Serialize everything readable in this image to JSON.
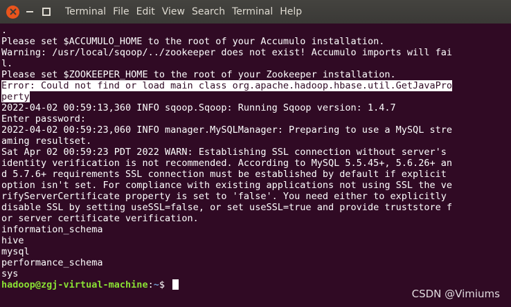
{
  "titlebar": {
    "menu": [
      "Terminal",
      "File",
      "Edit",
      "View",
      "Search",
      "Terminal",
      "Help"
    ]
  },
  "terminal": {
    "lines": [
      ".",
      "Please set $ACCUMULO_HOME to the root of your Accumulo installation.",
      "Warning: /usr/local/sqoop/../zookeeper does not exist! Accumulo imports will fai",
      "l.",
      "Please set $ZOOKEEPER_HOME to the root of your Zookeeper installation.",
      "Error: Could not find or load main class org.apache.hadoop.hbase.util.GetJavaPro",
      "perty",
      "2022-04-02 00:59:13,360 INFO sqoop.Sqoop: Running Sqoop version: 1.4.7",
      "Enter password:",
      "2022-04-02 00:59:23,060 INFO manager.MySQLManager: Preparing to use a MySQL stre",
      "aming resultset.",
      "Sat Apr 02 00:59:23 PDT 2022 WARN: Establishing SSL connection without server's",
      "identity verification is not recommended. According to MySQL 5.5.45+, 5.6.26+ an",
      "d 5.7.6+ requirements SSL connection must be established by default if explicit",
      "option isn't set. For compliance with existing applications not using SSL the ve",
      "rifyServerCertificate property is set to 'false'. You need either to explicitly",
      "disable SSL by setting useSSL=false, or set useSSL=true and provide truststore f",
      "or server certificate verification.",
      "information_schema",
      "hive",
      "mysql",
      "performance_schema",
      "sys"
    ],
    "prompt": {
      "user_host": "hadoop@zgj-virtual-machine",
      "separator": ":",
      "path": "~",
      "symbol": "$ "
    }
  },
  "watermark": "CSDN @Vimiums",
  "colors": {
    "background": "#300a24",
    "text": "#ffffff",
    "prompt_user": "#8ae234",
    "prompt_path": "#729fcf",
    "close_button": "#e9541c"
  }
}
